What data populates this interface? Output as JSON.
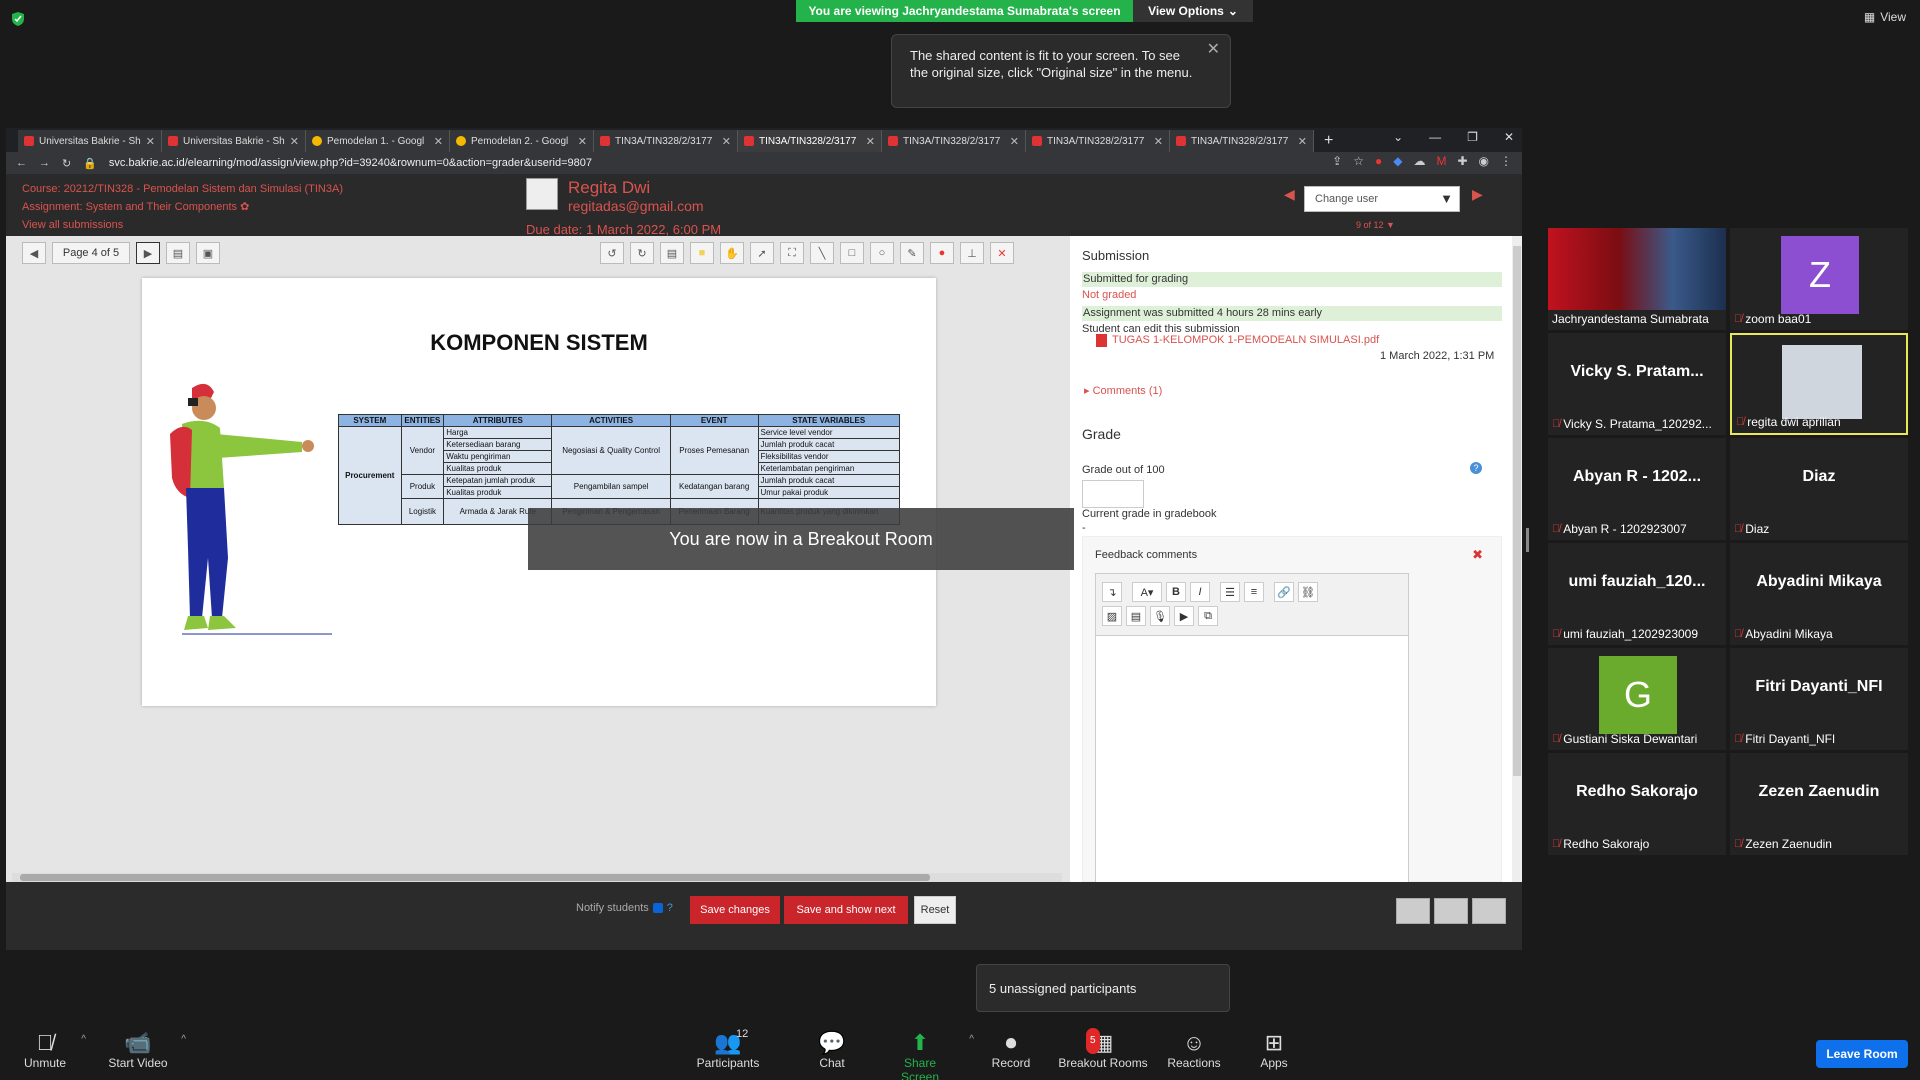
{
  "zoom": {
    "share_banner": "You are viewing Jachryandestama Sumabrata's screen",
    "view_options": "View Options",
    "tooltip": "The shared content is fit to your screen. To see the original size, click \"Original size\" in the menu.",
    "view_label": "View",
    "breakout_msg": "You are now in a Breakout Room",
    "unassigned": "5 unassigned participants",
    "controls": {
      "unmute": "Unmute",
      "start_video": "Start Video",
      "participants": "Participants",
      "participants_count": "12",
      "chat": "Chat",
      "share_screen": "Share Screen",
      "record": "Record",
      "breakout_rooms": "Breakout Rooms",
      "breakout_count": "5",
      "reactions": "Reactions",
      "apps": "Apps",
      "leave": "Leave Room"
    },
    "gallery": [
      {
        "display": "",
        "label": "Jachryandestama Sumabrata",
        "muted": false
      },
      {
        "display": "Z",
        "label": "zoom baa01",
        "muted": true
      },
      {
        "display": "Vicky S. Pratam...",
        "label": "Vicky S. Pratama_120292...",
        "muted": true
      },
      {
        "display": "",
        "label": "regita dwi aprilian",
        "muted": true
      },
      {
        "display": "Abyan R - 1202...",
        "label": "Abyan R - 1202923007",
        "muted": true
      },
      {
        "display": "Diaz",
        "label": "Diaz",
        "muted": true
      },
      {
        "display": "umi  fauziah_120...",
        "label": "umi fauziah_1202923009",
        "muted": true
      },
      {
        "display": "Abyadini Mikaya",
        "label": "Abyadini Mikaya",
        "muted": true
      },
      {
        "display": "G",
        "label": "Gustiani Siska Dewantari",
        "muted": true
      },
      {
        "display": "Fitri Dayanti_NFI",
        "label": "Fitri Dayanti_NFI",
        "muted": true
      },
      {
        "display": "Redho Sakorajo",
        "label": "Redho Sakorajo",
        "muted": true
      },
      {
        "display": "Zezen Zaenudin",
        "label": "Zezen Zaenudin",
        "muted": true
      }
    ]
  },
  "browser": {
    "tabs": [
      {
        "label": "Universitas Bakrie - Sh",
        "icon": "red"
      },
      {
        "label": "Universitas Bakrie - Sh",
        "icon": "red"
      },
      {
        "label": "Pemodelan 1. - Googl",
        "icon": "drive"
      },
      {
        "label": "Pemodelan 2. - Googl",
        "icon": "drive"
      },
      {
        "label": "TIN3A/TIN328/2/3177",
        "icon": "red"
      },
      {
        "label": "TIN3A/TIN328/2/3177",
        "icon": "red",
        "active": true
      },
      {
        "label": "TIN3A/TIN328/2/3177",
        "icon": "red"
      },
      {
        "label": "TIN3A/TIN328/2/3177",
        "icon": "red"
      },
      {
        "label": "TIN3A/TIN328/2/3177",
        "icon": "red"
      }
    ],
    "url": "svc.bakrie.ac.id/elearning/mod/assign/view.php?id=39240&rownum=0&action=grader&userid=9807"
  },
  "moodle": {
    "course": "Course: 20212/TIN328 - Pemodelan Sistem dan Simulasi (TIN3A)",
    "assignment": "Assignment: System and Their Components",
    "view_all": "View all submissions",
    "user_name": "Regita Dwi",
    "user_email": "regitadas@gmail.com",
    "due_date": "Due date: 1 March 2022, 6:00 PM",
    "change_user": "Change user",
    "user_count": "9 of 12",
    "page_info": "Page 4 of 5",
    "pdf": {
      "title": "KOMPONEN SISTEM",
      "headers": [
        "SYSTEM",
        "ENTITIES",
        "ATTRIBUTES",
        "ACTIVITIES",
        "EVENT",
        "STATE VARIABLES"
      ],
      "system": "Procurement",
      "entities": [
        "Vendor",
        "Produk",
        "Logistik"
      ],
      "attributes": [
        "Harga",
        "Ketersediaan barang",
        "Waktu pengiriman",
        "Kualitas produk",
        "Ketepatan jumlah produk",
        "Kualitas produk",
        "Armada & Jarak Rute"
      ],
      "activities": [
        "Negosiasi & Quality Control",
        "Pengambilan sampel",
        "Pengiriman & Pengemasan"
      ],
      "events": [
        "Proses Pemesanan",
        "Kedatangan barang",
        "Penerimaan Barang"
      ],
      "state_vars": [
        "Service level vendor",
        "Jumlah produk cacat",
        "Fleksibilitas vendor",
        "Keterlambatan pengiriman",
        "Jumlah produk cacat",
        "Umur pakai produk",
        "Kuantitas produk yang dikirimkan"
      ]
    },
    "submission": {
      "heading": "Submission",
      "status1": "Submitted for grading",
      "status2": "Not graded",
      "status3": "Assignment was submitted 4 hours 28 mins early",
      "status4": "Student can edit this submission",
      "file": "TUGAS 1-KELOMPOK 1-PEMODEALN SIMULASI.pdf",
      "file_date": "1 March 2022, 1:31 PM",
      "comments": "Comments (1)"
    },
    "grade": {
      "heading": "Grade",
      "out_of": "Grade out of 100",
      "current": "Current grade in gradebook",
      "current_value": "-",
      "feedback": "Feedback comments"
    },
    "footer": {
      "notify": "Notify students",
      "save": "Save changes",
      "save_show": "Save and show next",
      "reset": "Reset"
    }
  }
}
